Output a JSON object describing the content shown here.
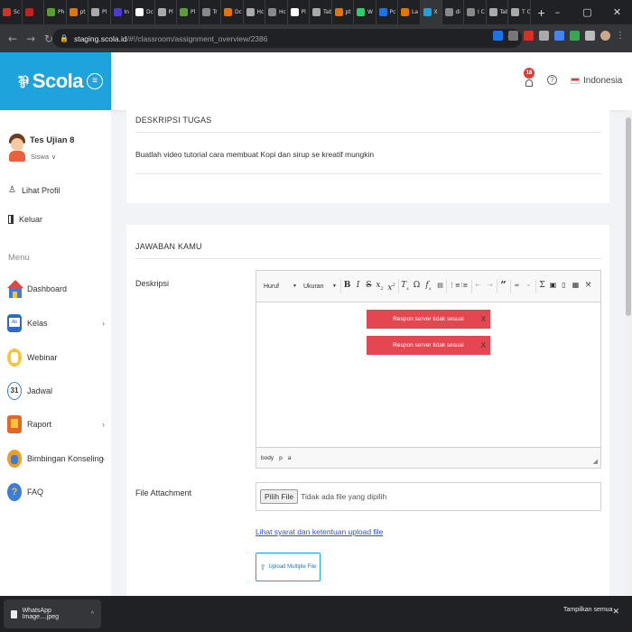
{
  "browser": {
    "tabs": [
      {
        "label": "Sc",
        "color": "#d93025"
      },
      {
        "label": "",
        "color": "#c5221f"
      },
      {
        "label": "Ph",
        "color": "#5c9e31"
      },
      {
        "label": "pt",
        "color": "#e37400"
      },
      {
        "label": "Pl",
        "color": "#aaaaaa"
      },
      {
        "label": "In",
        "color": "#4b3bcf"
      },
      {
        "label": "Dc",
        "color": "#ffffff"
      },
      {
        "label": "Pl",
        "color": "#aaaaaa"
      },
      {
        "label": "Pl",
        "color": "#5c9e31"
      },
      {
        "label": "Tr",
        "color": "#888888"
      },
      {
        "label": "Dc",
        "color": "#e37400"
      },
      {
        "label": "Hc",
        "color": "#aaaaaa"
      },
      {
        "label": "Hc",
        "color": "#888888"
      },
      {
        "label": "Pl",
        "color": "#ffffff"
      },
      {
        "label": "Tab Bu",
        "color": "#aaaaaa"
      },
      {
        "label": "pt",
        "color": "#e37400"
      },
      {
        "label": "W",
        "color": "#25d366"
      },
      {
        "label": "Pc",
        "color": "#1a73e8"
      },
      {
        "label": "La",
        "color": "#e37400"
      },
      {
        "label": "X",
        "color": "#1fa3dc"
      },
      {
        "label": "di",
        "color": "#888888"
      },
      {
        "label": "I C",
        "color": "#888888"
      },
      {
        "label": "Tab Bu",
        "color": "#aaaaaa"
      },
      {
        "label": "T Ot",
        "color": "#aaaaaa"
      }
    ],
    "new_tab": "+",
    "window_controls": [
      "–",
      "▢",
      "✕"
    ],
    "url_host": "staging.scola.id",
    "url_path": "/#!/classroom/assignment_overview/2386"
  },
  "app": {
    "logo": "Scola",
    "notification_count": "18",
    "help": "?",
    "language": "Indonesia"
  },
  "sidebar": {
    "user_name": "Tes Ujian 8",
    "user_role": "Siswa",
    "profile_link": "Lihat Profil",
    "logout_link": "Keluar",
    "menu_heading": "Menu",
    "items": [
      {
        "label": "Dashboard",
        "icon": "house-icon",
        "chevron": ""
      },
      {
        "label": "Kelas",
        "icon": "class-icon",
        "chevron": "›"
      },
      {
        "label": "Webinar",
        "icon": "webinar-icon",
        "chevron": ""
      },
      {
        "label": "Jadwal",
        "icon": "calendar-icon",
        "chevron": ""
      },
      {
        "label": "Raport",
        "icon": "report-icon",
        "chevron": "›"
      },
      {
        "label": "Bimbingan Konseling",
        "icon": "counseling-icon",
        "chevron": "›"
      },
      {
        "label": "FAQ",
        "icon": "faq-icon",
        "chevron": ""
      }
    ]
  },
  "task": {
    "title": "DESKRIPSI TUGAS",
    "description": "Buatlah video tutorial cara membuat Kopi  dan sirup se kreatif mungkin"
  },
  "answer": {
    "title": "JAWABAN KAMU",
    "description_label": "Deskripsi",
    "editor": {
      "font_combo": "Huruf",
      "size_combo": "Ukuran",
      "errors": [
        "Respon server tidak sesuai",
        "Respon server tidak sesuai"
      ],
      "error_close": "X",
      "path": [
        "body",
        "p",
        "a"
      ]
    },
    "file_label": "File Attachment",
    "file_button": "Pilih File",
    "file_status": "Tidak ada file yang dipilih",
    "terms_link": "Lihat syarat dan ketentuan upload file",
    "upload_button": "Upload Multiple File"
  },
  "downloads": {
    "file_name": "WhatsApp Image....jpeg",
    "show_all": "Tampilkan semua",
    "close": "✕"
  }
}
